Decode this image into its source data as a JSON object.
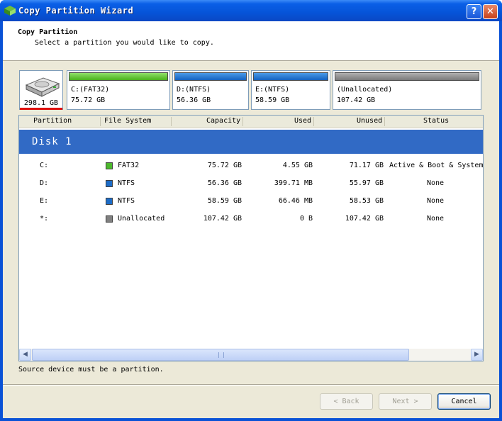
{
  "window": {
    "title": "Copy Partition Wizard",
    "help": "?",
    "close": "✕"
  },
  "header": {
    "title": "Copy Partition",
    "subtitle": "Select a partition you would like to copy."
  },
  "disk_map": {
    "disk_size": "298.1 GB",
    "partitions": [
      {
        "name": "C:(FAT32)",
        "capacity": "75.72 GB",
        "bar": "green"
      },
      {
        "name": "D:(NTFS)",
        "capacity": "56.36 GB",
        "bar": "blue"
      },
      {
        "name": "E:(NTFS)",
        "capacity": "58.59 GB",
        "bar": "blue"
      },
      {
        "name": "(Unallocated)",
        "capacity": "107.42 GB",
        "bar": "gray"
      }
    ]
  },
  "table": {
    "columns": [
      "Partition",
      "File System",
      "Capacity",
      "Used",
      "Unused",
      "Status"
    ],
    "disk_label": "Disk 1",
    "rows": [
      {
        "partition": "C:",
        "fs": "FAT32",
        "fs_color": "#4cb82c",
        "capacity": "75.72 GB",
        "used": "4.55 GB",
        "unused": "71.17 GB",
        "status": "Active & Boot & System"
      },
      {
        "partition": "D:",
        "fs": "NTFS",
        "fs_color": "#1c6cc8",
        "capacity": "56.36 GB",
        "used": "399.71 MB",
        "unused": "55.97 GB",
        "status": "None"
      },
      {
        "partition": "E:",
        "fs": "NTFS",
        "fs_color": "#1c6cc8",
        "capacity": "58.59 GB",
        "used": "66.46 MB",
        "unused": "58.53 GB",
        "status": "None"
      },
      {
        "partition": "*:",
        "fs": "Unallocated",
        "fs_color": "#808080",
        "capacity": "107.42 GB",
        "used": "0 B",
        "unused": "107.42 GB",
        "status": "None"
      }
    ]
  },
  "status_message": "Source device must be a partition.",
  "buttons": {
    "back": "< Back",
    "next": "Next >",
    "cancel": "Cancel"
  },
  "icons": {
    "app": "wizard-icon",
    "disk": "hard-disk-icon"
  }
}
